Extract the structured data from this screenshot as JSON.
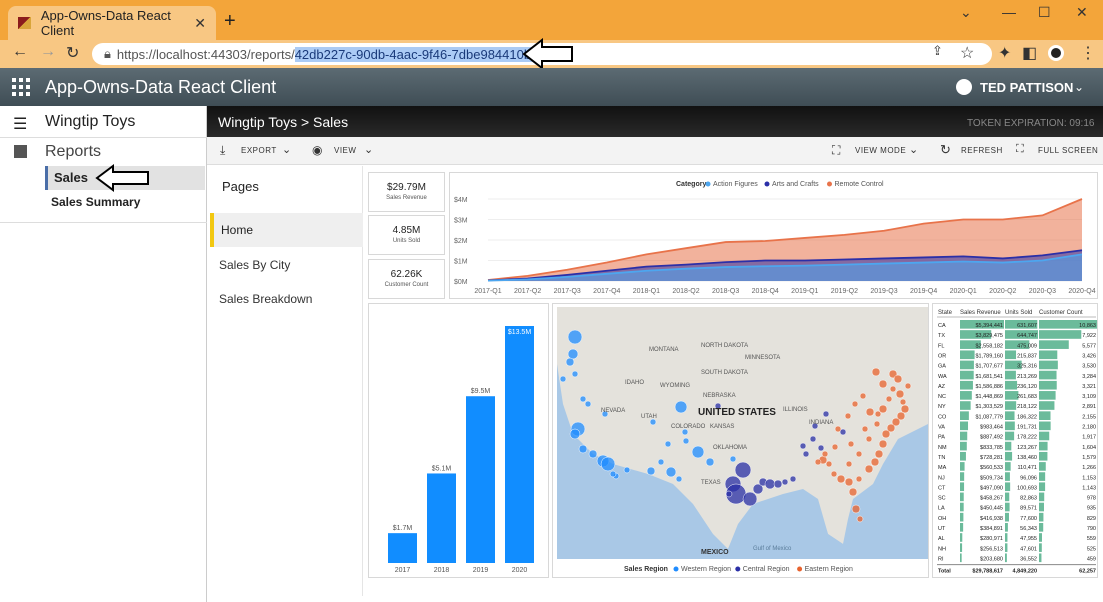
{
  "browser": {
    "tab_title": "App-Owns-Data React Client",
    "url_prefix": "https://localhost:44303/reports/",
    "url_id": "42db227c-90db-4aac-9f46-7dbe984410b2"
  },
  "app": {
    "title": "App-Owns-Data React Client",
    "user": "TED PATTISON"
  },
  "nav": {
    "workspace": "Wingtip Toys",
    "reports_label": "Reports",
    "items": [
      "Sales",
      "Sales Summary"
    ]
  },
  "report": {
    "breadcrumb": "Wingtip Toys > Sales",
    "token": "TOKEN EXPIRATION: 09:16",
    "toolbar": {
      "export": "EXPORT",
      "view": "VIEW",
      "view_mode": "VIEW MODE",
      "refresh": "REFRESH",
      "full_screen": "FULL SCREEN"
    },
    "pages_header": "Pages",
    "pages": [
      "Home",
      "Sales By City",
      "Sales Breakdown"
    ],
    "cards": [
      {
        "value": "$29.79M",
        "label": "Sales Revenue"
      },
      {
        "value": "4.85M",
        "label": "Units Sold"
      },
      {
        "value": "62.26K",
        "label": "Customer Count"
      }
    ],
    "map_legend": {
      "title": "Sales Region",
      "items": [
        "Western Region",
        "Central Region",
        "Eastern Region"
      ]
    },
    "map_labels": [
      "UNITED STATES",
      "MONTANA",
      "NORTH DAKOTA",
      "MINNESOTA",
      "IDAHO",
      "WYOMING",
      "SOUTH DAKOTA",
      "NEBRASKA",
      "NEVADA",
      "UTAH",
      "COLORADO",
      "KANSAS",
      "ILLINOIS",
      "INDIANA",
      "OKLAHOMA",
      "TEXAS",
      "MEXICO",
      "Gulf of Mexico"
    ],
    "table": {
      "headers": [
        "State",
        "Sales Revenue",
        "Units Sold",
        "Customer Count"
      ],
      "rows": [
        [
          "CA",
          "$5,394,441",
          "631,607",
          "10,863"
        ],
        [
          "TX",
          "$3,829,475",
          "644,747",
          "7,922"
        ],
        [
          "FL",
          "$2,558,182",
          "475,009",
          "5,577"
        ],
        [
          "OR",
          "$1,789,160",
          "215,837",
          "3,426"
        ],
        [
          "GA",
          "$1,707,677",
          "325,316",
          "3,530"
        ],
        [
          "WA",
          "$1,681,541",
          "213,269",
          "3,284"
        ],
        [
          "AZ",
          "$1,586,886",
          "236,120",
          "3,321"
        ],
        [
          "NC",
          "$1,448,869",
          "261,683",
          "3,109"
        ],
        [
          "NY",
          "$1,303,529",
          "218,122",
          "2,891"
        ],
        [
          "CO",
          "$1,087,779",
          "186,322",
          "2,155"
        ],
        [
          "VA",
          "$983,464",
          "191,731",
          "2,180"
        ],
        [
          "PA",
          "$887,492",
          "178,222",
          "1,917"
        ],
        [
          "NM",
          "$833,785",
          "123,267",
          "1,604"
        ],
        [
          "TN",
          "$728,281",
          "138,460",
          "1,579"
        ],
        [
          "MA",
          "$560,533",
          "110,471",
          "1,266"
        ],
        [
          "NJ",
          "$509,734",
          "96,096",
          "1,153"
        ],
        [
          "CT",
          "$497,090",
          "100,693",
          "1,143"
        ],
        [
          "SC",
          "$458,267",
          "82,863",
          "978"
        ],
        [
          "LA",
          "$450,445",
          "89,571",
          "935"
        ],
        [
          "OH",
          "$416,938",
          "77,600",
          "829"
        ],
        [
          "UT",
          "$384,891",
          "56,343",
          "790"
        ],
        [
          "AL",
          "$280,971",
          "47,955",
          "559"
        ],
        [
          "NH",
          "$256,513",
          "47,601",
          "525"
        ],
        [
          "RI",
          "$203,680",
          "36,552",
          "459"
        ]
      ],
      "total": [
        "Total",
        "$29,788,617",
        "4,849,220",
        "62,257"
      ]
    }
  },
  "chart_data": [
    {
      "type": "area",
      "title": "",
      "legend_title": "Category",
      "legend_position": "top",
      "x": [
        "2017-Q1",
        "2017-Q2",
        "2017-Q3",
        "2017-Q4",
        "2018-Q1",
        "2018-Q2",
        "2018-Q3",
        "2018-Q4",
        "2019-Q1",
        "2019-Q2",
        "2019-Q3",
        "2019-Q4",
        "2020-Q1",
        "2020-Q2",
        "2020-Q3",
        "2020-Q4"
      ],
      "y_ticks": [
        "$0M",
        "$1M",
        "$2M",
        "$3M",
        "$4M"
      ],
      "ylim": [
        0,
        4
      ],
      "series": [
        {
          "name": "Remote Control",
          "color": "#e8734a",
          "values": [
            0.05,
            0.25,
            0.55,
            0.9,
            1.3,
            1.6,
            1.9,
            1.95,
            2.1,
            2.25,
            2.45,
            2.8,
            3.0,
            3.0,
            3.2,
            4.0
          ]
        },
        {
          "name": "Arts and Crafts",
          "color": "#2b2fa8",
          "values": [
            0.03,
            0.12,
            0.3,
            0.5,
            0.7,
            0.8,
            0.92,
            1.0,
            1.0,
            1.05,
            1.1,
            1.15,
            1.2,
            1.1,
            1.25,
            1.5
          ]
        },
        {
          "name": "Action Figures",
          "color": "#4da6ef",
          "values": [
            0.02,
            0.08,
            0.2,
            0.35,
            0.5,
            0.6,
            0.68,
            0.72,
            0.75,
            0.8,
            0.85,
            0.9,
            0.95,
            0.9,
            1.0,
            1.3
          ]
        }
      ]
    },
    {
      "type": "bar",
      "title": "",
      "categories": [
        "2017",
        "2018",
        "2019",
        "2020"
      ],
      "values": [
        1.7,
        5.1,
        9.5,
        13.5
      ],
      "data_labels": [
        "$1.7M",
        "$5.1M",
        "$9.5M",
        "$13.5M"
      ],
      "color": "#118dff",
      "ylim": [
        0,
        13.5
      ]
    }
  ]
}
